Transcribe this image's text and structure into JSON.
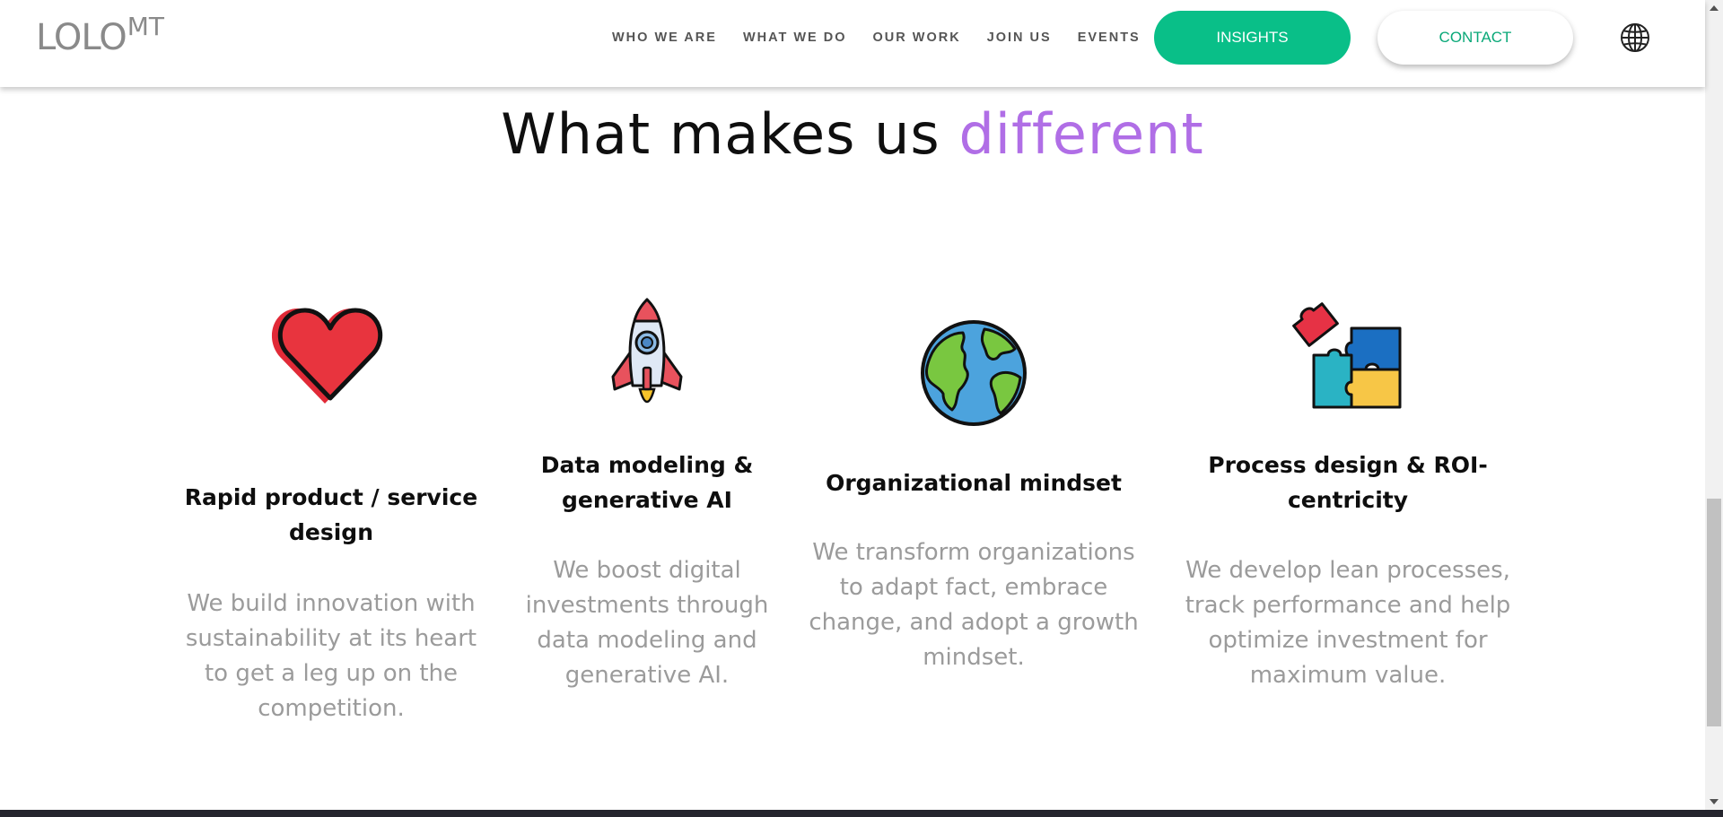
{
  "header": {
    "logo": {
      "main": "LOLO",
      "sup": "MT"
    },
    "nav": [
      {
        "label": "WHO WE ARE"
      },
      {
        "label": "WHAT WE DO"
      },
      {
        "label": "OUR WORK"
      },
      {
        "label": "JOIN US"
      },
      {
        "label": "EVENTS"
      }
    ],
    "insights_label": "INSIGHTS",
    "contact_label": "CONTACT",
    "language_icon": "globe-icon"
  },
  "main": {
    "headline": {
      "text": "What makes us",
      "accent": "different"
    },
    "features": [
      {
        "icon": "heart-icon",
        "title": "Rapid product / service design",
        "description": "We build innovation with sustainability at its heart to get a leg up on the competition."
      },
      {
        "icon": "rocket-icon",
        "title": "Data modeling & generative AI",
        "description": "We boost digital investments through data modeling and generative AI."
      },
      {
        "icon": "earth-icon",
        "title": "Organizational mindset",
        "description": "We transform organizations to adapt fact, embrace change, and adopt a growth mindset."
      },
      {
        "icon": "puzzle-icon",
        "title": "Process design & ROI-centricity",
        "description": "We develop lean processes, track performance and help optimize investment for maximum value."
      }
    ]
  },
  "colors": {
    "accent_green": "#09bf88",
    "headline_accent": "#b06ee6",
    "body_text": "#9b9b9b",
    "title_text": "#0e0e0e"
  }
}
